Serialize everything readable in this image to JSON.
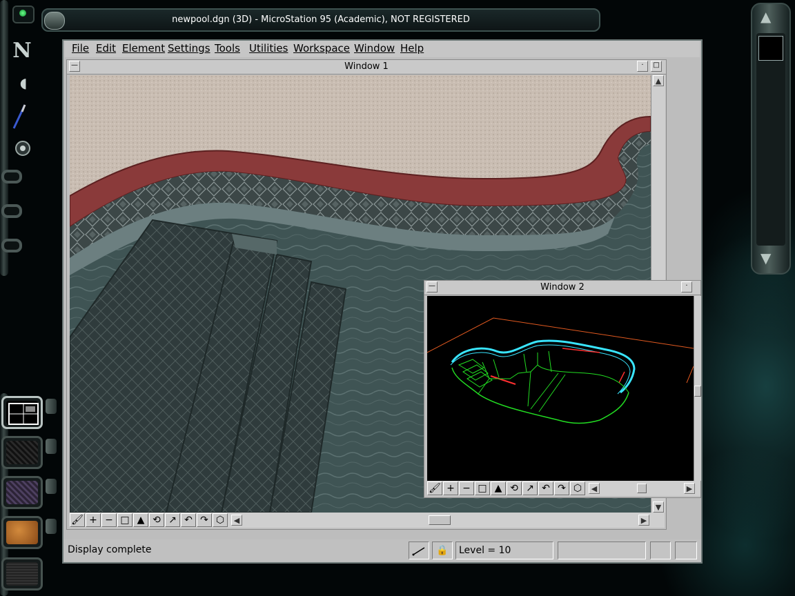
{
  "app": {
    "title": "newpool.dgn (3D) - MicroStation 95 (Academic), NOT REGISTERED"
  },
  "menu": [
    "File",
    "Edit",
    "Element",
    "Settings",
    "Tools",
    "Utilities",
    "Workspace",
    "Window",
    "Help"
  ],
  "window1": {
    "title": "Window 1",
    "content": "rendered-pool-view"
  },
  "window2": {
    "title": "Window 2",
    "content": "wireframe-pool-view"
  },
  "view_tools": [
    {
      "icon": "update-view-icon",
      "glyph": "🖌"
    },
    {
      "icon": "zoom-in-icon",
      "glyph": "+"
    },
    {
      "icon": "zoom-out-icon",
      "glyph": "−"
    },
    {
      "icon": "window-area-icon",
      "glyph": "□"
    },
    {
      "icon": "fit-view-icon",
      "glyph": "▲"
    },
    {
      "icon": "rotate-view-icon",
      "glyph": "⟲"
    },
    {
      "icon": "pan-view-icon",
      "glyph": "↗"
    },
    {
      "icon": "view-previous-icon",
      "glyph": "↶"
    },
    {
      "icon": "view-next-icon",
      "glyph": "↷"
    },
    {
      "icon": "view-3d-cube-icon",
      "glyph": "⬡"
    }
  ],
  "status": {
    "message": "Display complete",
    "level": "Level = 10"
  },
  "colors": {
    "wire_cyan": "#39e5ff",
    "wire_green": "#22dd22",
    "wire_red": "#ff3030",
    "wire_orange": "#e35a20",
    "pool_water": "#3f5454",
    "pool_coping": "#8a3a3a",
    "deck": "#c9bdb2"
  },
  "dock": {
    "launcher_icons": [
      "n-logo-icon",
      "mouse-icon",
      "pen-icon",
      "speaker-icon",
      "dock-slot-icon",
      "dock-slot-icon",
      "dock-slot-icon"
    ],
    "material_tiles": [
      "material-grid-tile",
      "material-black-tile",
      "material-purple-tile",
      "material-orange-tile",
      "material-dark-tile"
    ]
  }
}
